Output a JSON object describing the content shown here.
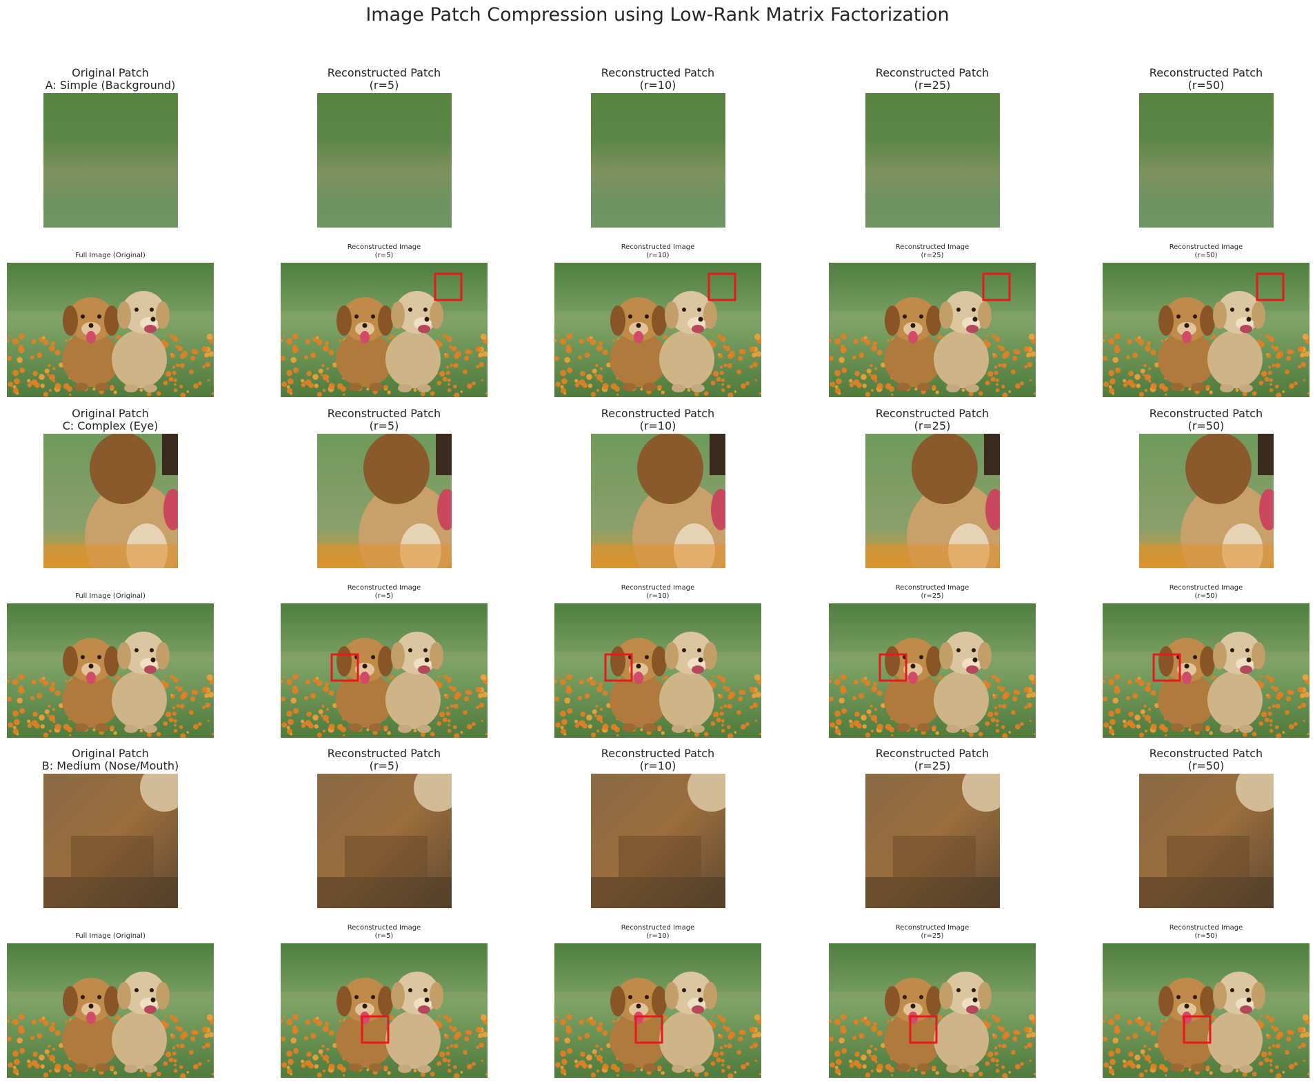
{
  "figure": {
    "title": "Image Patch Compression using Low-Rank Matrix Factorization"
  },
  "patch_rows": [
    {
      "scene": "background",
      "titles": [
        "Original Patch\nA: Simple (Background)",
        "Reconstructed Patch\n(r=5)",
        "Reconstructed Patch\n(r=10)",
        "Reconstructed Patch\n(r=25)",
        "Reconstructed Patch\n(r=50)"
      ]
    },
    {
      "scene": "eye",
      "titles": [
        "Original Patch\nC: Complex (Eye)",
        "Reconstructed Patch\n(r=5)",
        "Reconstructed Patch\n(r=10)",
        "Reconstructed Patch\n(r=25)",
        "Reconstructed Patch\n(r=50)"
      ]
    },
    {
      "scene": "nose",
      "titles": [
        "Original Patch\nB: Medium (Nose/Mouth)",
        "Reconstructed Patch\n(r=5)",
        "Reconstructed Patch\n(r=10)",
        "Reconstructed Patch\n(r=25)",
        "Reconstructed Patch\n(r=50)"
      ]
    }
  ],
  "full_rows": [
    {
      "titles": [
        "Full Image (Original)",
        "Reconstructed Image\n(r=5)",
        "Reconstructed Image\n(r=10)",
        "Reconstructed Image\n(r=25)",
        "Reconstructed Image\n(r=50)"
      ]
    },
    {
      "titles": [
        "Full Image (Original)",
        "Reconstructed Image\n(r=5)",
        "Reconstructed Image\n(r=10)",
        "Reconstructed Image\n(r=25)",
        "Reconstructed Image\n(r=50)"
      ]
    },
    {
      "titles": [
        "Full Image (Original)",
        "Reconstructed Image\n(r=5)",
        "Reconstructed Image\n(r=10)",
        "Reconstructed Image\n(r=25)",
        "Reconstructed Image\n(r=50)"
      ]
    }
  ],
  "colors": {
    "box": "#e8191c",
    "grass_dark": "#5e8b4a",
    "grass_light": "#7da265",
    "flowers": "#e57f22",
    "dog_golden": "#b07a3c",
    "dog_cream": "#dcc6a0",
    "tongue": "#d24a6a"
  },
  "icons": [
    "puppies-photo-icon",
    "red-box-icon"
  ]
}
